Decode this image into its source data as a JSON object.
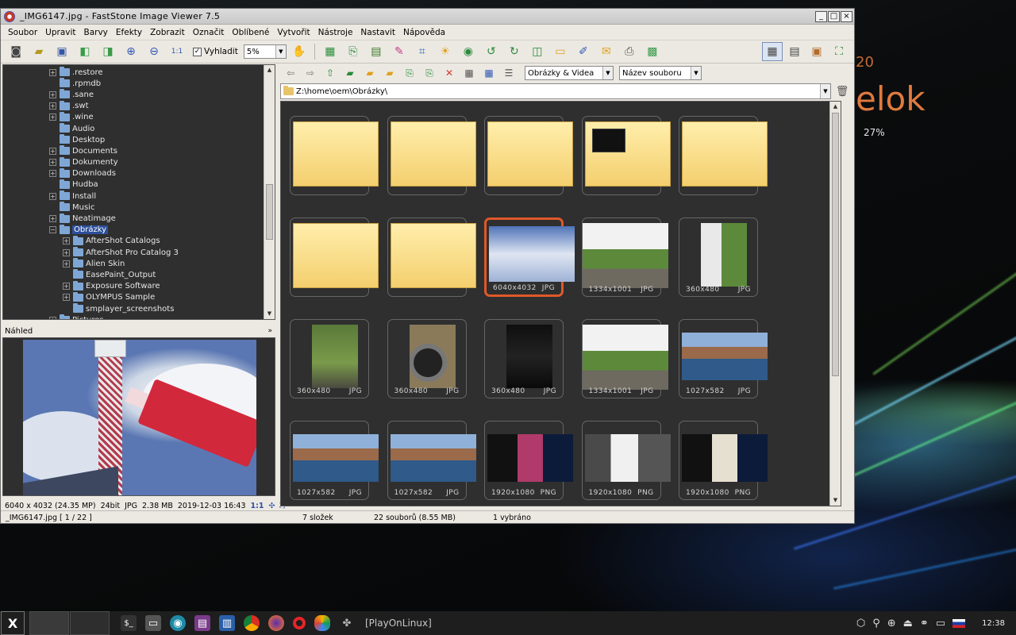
{
  "window": {
    "title": "_IMG6147.jpg - FastStone Image Viewer 7.5",
    "buttons": [
      "_",
      "□",
      "×"
    ]
  },
  "menu": [
    "Soubor",
    "Upravit",
    "Barvy",
    "Efekty",
    "Zobrazit",
    "Označit",
    "Oblíbené",
    "Vytvořit",
    "Nástroje",
    "Nastavit",
    "Nápověda"
  ],
  "toolbar": {
    "smooth_label": "Vyhladit",
    "smooth_checked": "✓",
    "zoom_value": "5%"
  },
  "tree": {
    "items": [
      {
        "label": ".restore",
        "exp": "+",
        "indent": 4
      },
      {
        "label": ".rpmdb",
        "exp": "",
        "indent": 4
      },
      {
        "label": ".sane",
        "exp": "+",
        "indent": 4
      },
      {
        "label": ".swt",
        "exp": "+",
        "indent": 4
      },
      {
        "label": ".wine",
        "exp": "+",
        "indent": 4
      },
      {
        "label": "Audio",
        "exp": "",
        "indent": 4
      },
      {
        "label": "Desktop",
        "exp": "",
        "indent": 4
      },
      {
        "label": "Documents",
        "exp": "+",
        "indent": 4
      },
      {
        "label": "Dokumenty",
        "exp": "+",
        "indent": 4
      },
      {
        "label": "Downloads",
        "exp": "+",
        "indent": 4
      },
      {
        "label": "Hudba",
        "exp": "",
        "indent": 4
      },
      {
        "label": "Install",
        "exp": "+",
        "indent": 4
      },
      {
        "label": "Music",
        "exp": "",
        "indent": 4
      },
      {
        "label": "Neatimage",
        "exp": "+",
        "indent": 4
      },
      {
        "label": "Obrázky",
        "exp": "−",
        "indent": 4,
        "selected": true
      },
      {
        "label": "AfterShot Catalogs",
        "exp": "+",
        "indent": 5
      },
      {
        "label": "AfterShot Pro Catalog 3",
        "exp": "+",
        "indent": 5
      },
      {
        "label": "Alien Skin",
        "exp": "+",
        "indent": 5
      },
      {
        "label": "EasePaint_Output",
        "exp": "",
        "indent": 5
      },
      {
        "label": "Exposure Software",
        "exp": "+",
        "indent": 5
      },
      {
        "label": "OLYMPUS Sample",
        "exp": "+",
        "indent": 5
      },
      {
        "label": "smplayer_screenshots",
        "exp": "",
        "indent": 5
      },
      {
        "label": "Pictures",
        "exp": "+",
        "indent": 4
      }
    ]
  },
  "preview": {
    "title": "Náhled",
    "info": {
      "dims": "6040 x 4032 (24.35 MP)",
      "depth": "24bit",
      "format": "JPG",
      "size": "2.38 MB",
      "date": "2019-12-03 16:43",
      "ratio": "1:1"
    }
  },
  "browser": {
    "filter": "Obrázky & Videa",
    "sort": "Název souboru",
    "path": "Z:\\home\\oem\\Obrázky\\"
  },
  "thumbnails": [
    {
      "type": "folder"
    },
    {
      "type": "folder"
    },
    {
      "type": "folder"
    },
    {
      "type": "folder-img"
    },
    {
      "type": "folder"
    },
    {
      "type": "folder"
    },
    {
      "type": "folder"
    },
    {
      "type": "img",
      "img": "tower",
      "dims": "6040x4032",
      "fmt": "JPG",
      "selected": true
    },
    {
      "type": "img",
      "img": "moto",
      "dims": "1334x1001",
      "fmt": "JPG"
    },
    {
      "type": "img",
      "img": "moto-v",
      "dims": "360x480",
      "fmt": "JPG"
    },
    {
      "type": "img",
      "img": "grass-v",
      "dims": "360x480",
      "fmt": "JPG"
    },
    {
      "type": "img",
      "img": "wheel-v",
      "dims": "360x480",
      "fmt": "JPG"
    },
    {
      "type": "img",
      "img": "dark-v",
      "dims": "360x480",
      "fmt": "JPG"
    },
    {
      "type": "img",
      "img": "moto",
      "dims": "1334x1001",
      "fmt": "JPG"
    },
    {
      "type": "img",
      "img": "bridge",
      "dims": "1027x582",
      "fmt": "JPG"
    },
    {
      "type": "img",
      "img": "bridge",
      "dims": "1027x582",
      "fmt": "JPG"
    },
    {
      "type": "img",
      "img": "bridge",
      "dims": "1027x582",
      "fmt": "JPG"
    },
    {
      "type": "img",
      "img": "screen-pink",
      "dims": "1920x1080",
      "fmt": "PNG"
    },
    {
      "type": "img",
      "img": "screen-doc",
      "dims": "1920x1080",
      "fmt": "PNG"
    },
    {
      "type": "img",
      "img": "screen-photo",
      "dims": "1920x1080",
      "fmt": "PNG"
    }
  ],
  "status": {
    "file": "_IMG6147.jpg [ 1 / 22 ]",
    "folders": "7 složek",
    "files": "22 souborů (8.55 MB)",
    "selected": "1 vybráno"
  },
  "desktop": {
    "big_text": "elok",
    "small_text": "20",
    "percent": "27%"
  },
  "taskbar": {
    "start": "X",
    "playonlinux": "[PlayOnLinux]",
    "clock": "12:38"
  }
}
